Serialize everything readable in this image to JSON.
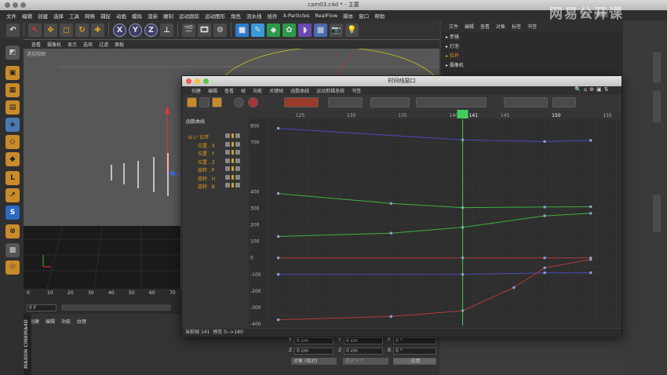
{
  "window_title": "cam03.c4d * - 主要",
  "watermark": "网易公开课",
  "menubar": [
    "文件",
    "编辑",
    "创建",
    "选择",
    "工具",
    "网格",
    "捕捉",
    "动画",
    "模拟",
    "渲染",
    "雕刻",
    "运动跟踪",
    "运动图形",
    "角色",
    "流水线",
    "插件",
    "X-Particles",
    "RealFlow",
    "脚本",
    "窗口",
    "帮助"
  ],
  "right_menu": {
    "layout_label": "界面",
    "layout_value": "启动"
  },
  "toolbar": {
    "x": "X",
    "y": "Y",
    "z": "Z"
  },
  "viewport": {
    "menu": [
      "查看",
      "摄像机",
      "显示",
      "选项",
      "过滤",
      "面板"
    ],
    "label": "透视视图"
  },
  "timeline": {
    "ticks": [
      "0",
      "10",
      "20",
      "30",
      "40",
      "50",
      "60",
      "70"
    ],
    "frame_field": "0 F"
  },
  "object_manager": {
    "menu": [
      "文件",
      "编辑",
      "查看",
      "对象",
      "标签",
      "书签"
    ],
    "objects": [
      "参镜",
      "灯泡",
      "拉开",
      "摄像机"
    ]
  },
  "bottom_panel": {
    "menu": [
      "创建",
      "编辑",
      "功能",
      "纹理"
    ],
    "coords": {
      "y_label": "Y",
      "y_value": "0 cm",
      "z_label": "Z",
      "z_value": "0 cm",
      "y2_label": "Y",
      "y2_value": "0 cm",
      "z2_label": "Z",
      "z2_value": "0 cm",
      "p_label": "P",
      "p_value": "0 °",
      "b_label": "B",
      "b_value": "0 °",
      "mode_select": "对象 (相对)",
      "size_select": "绝对尺寸",
      "apply_button": "应用"
    }
  },
  "brand": "MAXON CINEMA4D",
  "timeline_window": {
    "title": "时间线窗口",
    "menu": [
      "创建",
      "编辑",
      "查看",
      "帧",
      "功能",
      "关键帧",
      "函数曲线",
      "运动剪辑系统",
      "书签"
    ],
    "section_label": "函数曲线",
    "tracks": [
      {
        "label": "拉开"
      },
      {
        "label": "位置 . X"
      },
      {
        "label": "位置 . Y"
      },
      {
        "label": "位置 . Z"
      },
      {
        "label": "旋转 . P"
      },
      {
        "label": "旋转 . H"
      },
      {
        "label": "旋转 . B"
      }
    ],
    "status_current_frame_label": "当前帧",
    "status_current_frame": "141",
    "status_preview_label": "预览",
    "status_preview": "0-->180"
  },
  "chart_data": {
    "type": "line",
    "x_ticks": [
      125,
      130,
      135,
      140,
      141,
      145,
      150,
      155
    ],
    "x_current": 141,
    "xlim": [
      121.5,
      156.5
    ],
    "y_ticks": [
      800,
      700,
      400,
      300,
      200,
      100,
      0,
      -100,
      -200,
      -300,
      -400
    ],
    "ylim": [
      -410,
      840
    ],
    "series": [
      {
        "color": "#4a4ab8",
        "points": [
          [
            123,
            785
          ],
          [
            141,
            715
          ],
          [
            149,
            705
          ],
          [
            153.5,
            712
          ]
        ]
      },
      {
        "color": "#3fae3f",
        "points": [
          [
            123,
            390
          ],
          [
            134,
            330
          ],
          [
            141,
            305
          ],
          [
            149,
            308
          ],
          [
            153.5,
            310
          ]
        ]
      },
      {
        "color": "#3fae3f",
        "points": [
          [
            123,
            130
          ],
          [
            134,
            150
          ],
          [
            141,
            185
          ],
          [
            149,
            255
          ],
          [
            153.5,
            270
          ]
        ]
      },
      {
        "color": "#b43a3a",
        "points": [
          [
            123,
            0
          ],
          [
            141,
            0
          ],
          [
            149,
            0
          ],
          [
            153.5,
            0
          ]
        ]
      },
      {
        "color": "#4a4ab8",
        "points": [
          [
            123,
            -100
          ],
          [
            141,
            -100
          ],
          [
            149,
            -90
          ],
          [
            153.5,
            -90
          ]
        ]
      },
      {
        "color": "#b43a3a",
        "points": [
          [
            123,
            -375
          ],
          [
            134,
            -355
          ],
          [
            141,
            -320
          ],
          [
            146,
            -180
          ],
          [
            149,
            -60
          ],
          [
            153.5,
            -10
          ]
        ]
      }
    ]
  }
}
